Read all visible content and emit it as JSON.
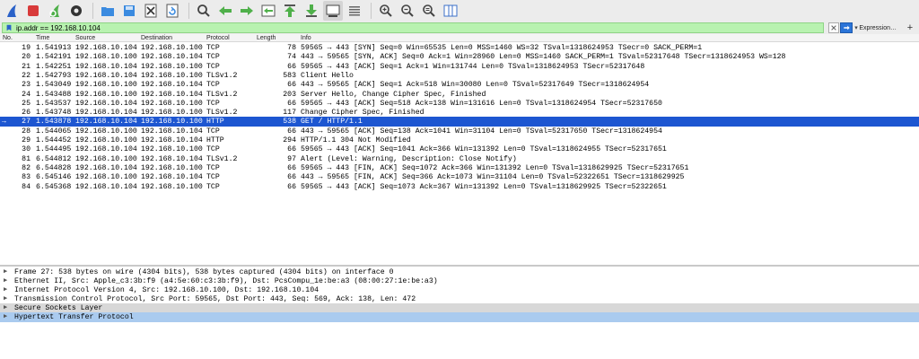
{
  "toolbar": {
    "buttons": [
      {
        "name": "shark-fin-start-icon",
        "color": "#2a61c8"
      },
      {
        "name": "stop-square-icon",
        "color": "#d83a3a"
      },
      {
        "name": "restart-fin-icon",
        "color": "#4fb04a"
      },
      {
        "name": "options-gear-icon",
        "color": "#333333"
      },
      {
        "name": "open-folder-icon",
        "color": "#3b8be0"
      },
      {
        "name": "save-file-icon",
        "color": "#3b8be0"
      },
      {
        "name": "close-file-icon",
        "color": "#555555"
      },
      {
        "name": "reload-icon",
        "color": "#3b8be0"
      },
      {
        "name": "find-magnifier-icon",
        "color": "#444444"
      },
      {
        "name": "go-back-arrow-icon",
        "color": "#4fb04a"
      },
      {
        "name": "go-forward-arrow-icon",
        "color": "#4fb04a"
      },
      {
        "name": "go-to-packet-icon",
        "color": "#4fb04a"
      },
      {
        "name": "first-packet-icon",
        "color": "#4fb04a"
      },
      {
        "name": "last-packet-icon",
        "color": "#4fb04a"
      },
      {
        "name": "autoscroll-icon",
        "color": "#444444"
      },
      {
        "name": "colorize-icon",
        "color": "#666666"
      },
      {
        "name": "zoom-in-icon",
        "color": "#444444"
      },
      {
        "name": "zoom-out-icon",
        "color": "#444444"
      },
      {
        "name": "normal-size-icon",
        "color": "#444444"
      },
      {
        "name": "resize-columns-icon",
        "color": "#3b6fc8"
      }
    ]
  },
  "filter": {
    "value": "ip.addr == 192.168.10.104",
    "expression_label": "Expression…",
    "plus_label": "+",
    "bg_color": "#b8f2b0"
  },
  "columns": {
    "no": "No.",
    "time": "Time",
    "source": "Source",
    "destination": "Destination",
    "protocol": "Protocol",
    "length": "Length",
    "info": "Info"
  },
  "packets": [
    {
      "no": "19",
      "time": "1.541913",
      "src": "192.168.10.104",
      "dst": "192.168.10.100",
      "proto": "TCP",
      "len": "78",
      "info": "59565 → 443 [SYN] Seq=0 Win=65535 Len=0 MSS=1460 WS=32 TSval=1318624953 TSecr=0 SACK_PERM=1"
    },
    {
      "no": "20",
      "time": "1.542191",
      "src": "192.168.10.100",
      "dst": "192.168.10.104",
      "proto": "TCP",
      "len": "74",
      "info": "443 → 59565 [SYN, ACK] Seq=0 Ack=1 Win=28960 Len=0 MSS=1460 SACK_PERM=1 TSval=52317648 TSecr=1318624953 WS=128"
    },
    {
      "no": "21",
      "time": "1.542251",
      "src": "192.168.10.104",
      "dst": "192.168.10.100",
      "proto": "TCP",
      "len": "66",
      "info": "59565 → 443 [ACK] Seq=1 Ack=1 Win=131744 Len=0 TSval=1318624953 TSecr=52317648"
    },
    {
      "no": "22",
      "time": "1.542793",
      "src": "192.168.10.104",
      "dst": "192.168.10.100",
      "proto": "TLSv1.2",
      "len": "583",
      "info": "Client Hello"
    },
    {
      "no": "23",
      "time": "1.543049",
      "src": "192.168.10.100",
      "dst": "192.168.10.104",
      "proto": "TCP",
      "len": "66",
      "info": "443 → 59565 [ACK] Seq=1 Ack=518 Win=30080 Len=0 TSval=52317649 TSecr=1318624954"
    },
    {
      "no": "24",
      "time": "1.543488",
      "src": "192.168.10.100",
      "dst": "192.168.10.104",
      "proto": "TLSv1.2",
      "len": "203",
      "info": "Server Hello, Change Cipher Spec, Finished"
    },
    {
      "no": "25",
      "time": "1.543537",
      "src": "192.168.10.104",
      "dst": "192.168.10.100",
      "proto": "TCP",
      "len": "66",
      "info": "59565 → 443 [ACK] Seq=518 Ack=138 Win=131616 Len=0 TSval=1318624954 TSecr=52317650"
    },
    {
      "no": "26",
      "time": "1.543748",
      "src": "192.168.10.104",
      "dst": "192.168.10.100",
      "proto": "TLSv1.2",
      "len": "117",
      "info": "Change Cipher Spec, Finished"
    },
    {
      "no": "27",
      "time": "1.543878",
      "src": "192.168.10.104",
      "dst": "192.168.10.100",
      "proto": "HTTP",
      "len": "538",
      "info": "GET / HTTP/1.1",
      "selected": true
    },
    {
      "no": "28",
      "time": "1.544065",
      "src": "192.168.10.100",
      "dst": "192.168.10.104",
      "proto": "TCP",
      "len": "66",
      "info": "443 → 59565 [ACK] Seq=138 Ack=1041 Win=31104 Len=0 TSval=52317650 TSecr=1318624954"
    },
    {
      "no": "29",
      "time": "1.544452",
      "src": "192.168.10.100",
      "dst": "192.168.10.104",
      "proto": "HTTP",
      "len": "294",
      "info": "HTTP/1.1 304 Not Modified"
    },
    {
      "no": "30",
      "time": "1.544495",
      "src": "192.168.10.104",
      "dst": "192.168.10.100",
      "proto": "TCP",
      "len": "66",
      "info": "59565 → 443 [ACK] Seq=1041 Ack=366 Win=131392 Len=0 TSval=1318624955 TSecr=52317651"
    },
    {
      "no": "81",
      "time": "6.544812",
      "src": "192.168.10.100",
      "dst": "192.168.10.104",
      "proto": "TLSv1.2",
      "len": "97",
      "info": "Alert (Level: Warning, Description: Close Notify)"
    },
    {
      "no": "82",
      "time": "6.544828",
      "src": "192.168.10.104",
      "dst": "192.168.10.100",
      "proto": "TCP",
      "len": "66",
      "info": "59565 → 443 [FIN, ACK] Seq=1072 Ack=366 Win=131392 Len=0 TSval=1318629925 TSecr=52317651"
    },
    {
      "no": "83",
      "time": "6.545146",
      "src": "192.168.10.100",
      "dst": "192.168.10.104",
      "proto": "TCP",
      "len": "66",
      "info": "443 → 59565 [FIN, ACK] Seq=366 Ack=1073 Win=31104 Len=0 TSval=52322651 TSecr=1318629925"
    },
    {
      "no": "84",
      "time": "6.545368",
      "src": "192.168.10.104",
      "dst": "192.168.10.100",
      "proto": "TCP",
      "len": "66",
      "info": "59565 → 443 [ACK] Seq=1073 Ack=367 Win=131392 Len=0 TSval=1318629925 TSecr=52322651"
    }
  ],
  "selection_colors": {
    "selected_bg": "#1d56d1",
    "selected_fg": "#ffffff"
  },
  "details": [
    {
      "text": "Frame 27: 538 bytes on wire (4304 bits), 538 bytes captured (4304 bits) on interface 0",
      "style": "normal"
    },
    {
      "text": "Ethernet II, Src: Apple_c3:3b:f9 (a4:5e:60:c3:3b:f9), Dst: PcsCompu_1e:be:a3 (08:00:27:1e:be:a3)",
      "style": "normal"
    },
    {
      "text": "Internet Protocol Version 4, Src: 192.168.10.100, Dst: 192.168.10.104",
      "style": "normal"
    },
    {
      "text": "Transmission Control Protocol, Src Port: 59565, Dst Port: 443, Seq: 569, Ack: 138, Len: 472",
      "style": "normal"
    },
    {
      "text": "Secure Sockets Layer",
      "style": "grey"
    },
    {
      "text": "Hypertext Transfer Protocol",
      "style": "hl"
    }
  ]
}
